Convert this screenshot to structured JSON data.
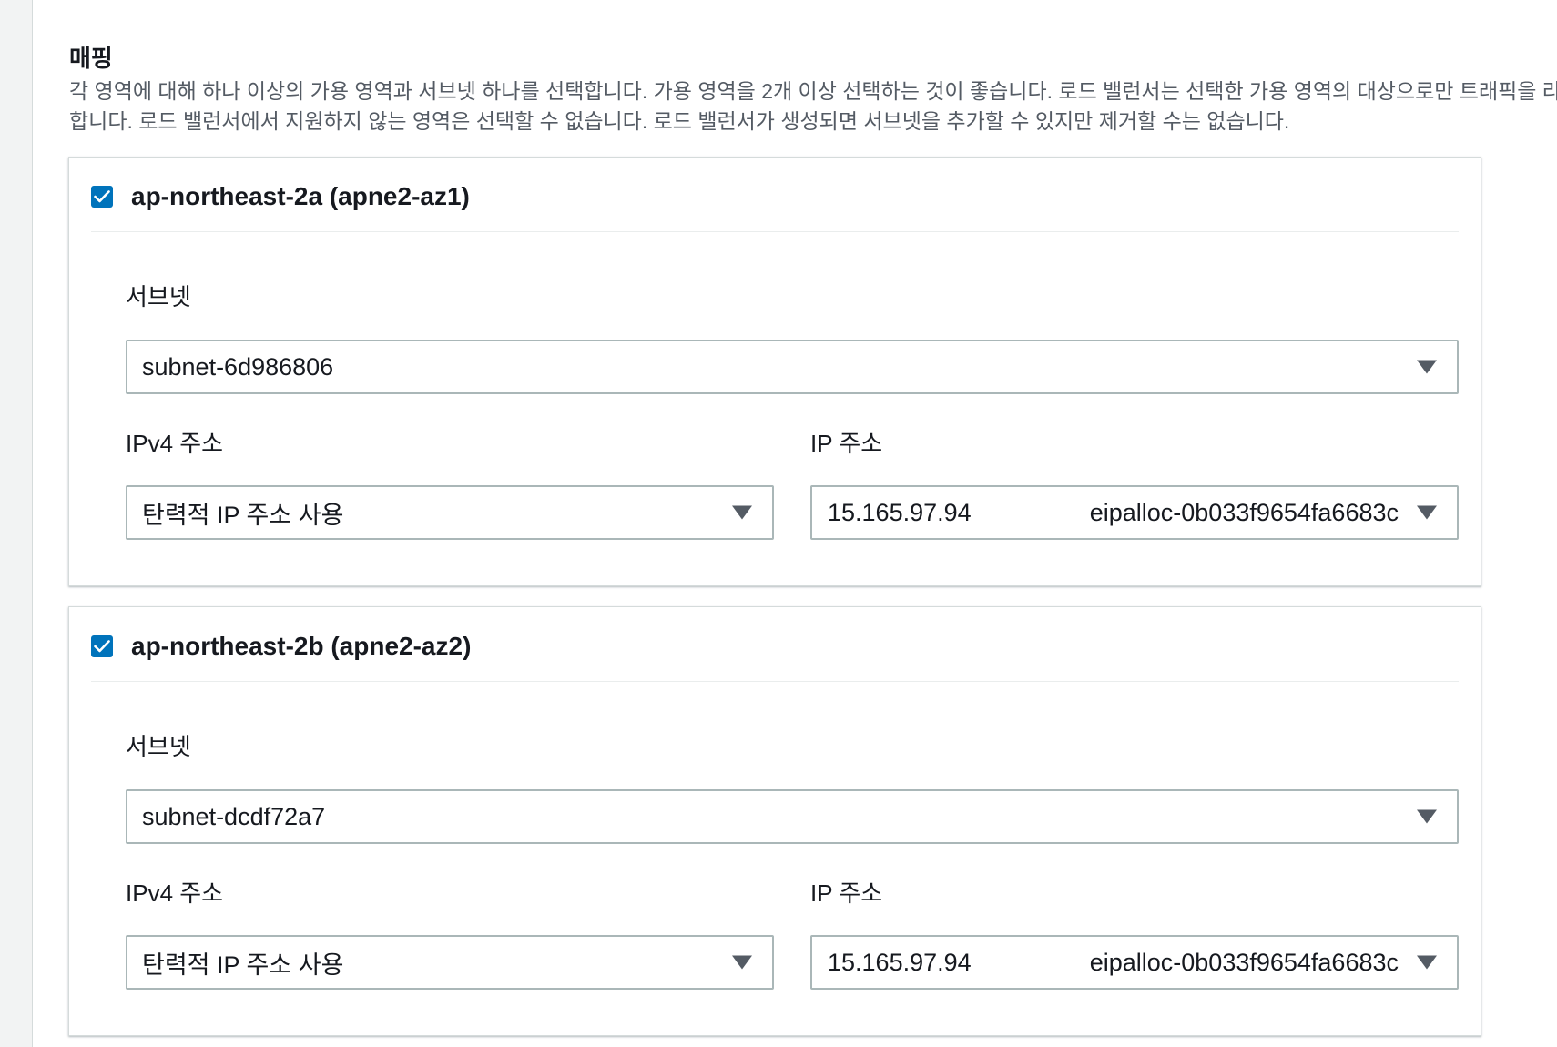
{
  "section": {
    "title": "매핑",
    "description": "각 영역에 대해 하나 이상의 가용 영역과 서브넷 하나를 선택합니다. 가용 영역을 2개 이상 선택하는 것이 좋습니다. 로드 밸런서는 선택한 가용 영역의 대상으로만 트래픽을 라우팅합니다. 로드 밸런서에서 지원하지 않는 영역은 선택할 수 없습니다. 로드 밸런서가 생성되면 서브넷을 추가할 수 있지만 제거할 수는 없습니다."
  },
  "zones": [
    {
      "name": "ap-northeast-2a (apne2-az1)",
      "checked": true,
      "subnet_label": "서브넷",
      "subnet_value": "subnet-6d986806",
      "ipv4_label": "IPv4 주소",
      "ipv4_value": "탄력적 IP 주소 사용",
      "ip_label": "IP 주소",
      "ip_value": "15.165.97.94",
      "ip_allocation": "eipalloc-0b033f9654fa6683c"
    },
    {
      "name": "ap-northeast-2b (apne2-az2)",
      "checked": true,
      "subnet_label": "서브넷",
      "subnet_value": "subnet-dcdf72a7",
      "ipv4_label": "IPv4 주소",
      "ipv4_value": "탄력적 IP 주소 사용",
      "ip_label": "IP 주소",
      "ip_value": "15.165.97.94",
      "ip_allocation": "eipalloc-0b033f9654fa6683c"
    }
  ],
  "colors": {
    "checkbox": "#0073bb",
    "border": "#aab7b8",
    "text": "#16191f",
    "muted": "#545b64"
  }
}
